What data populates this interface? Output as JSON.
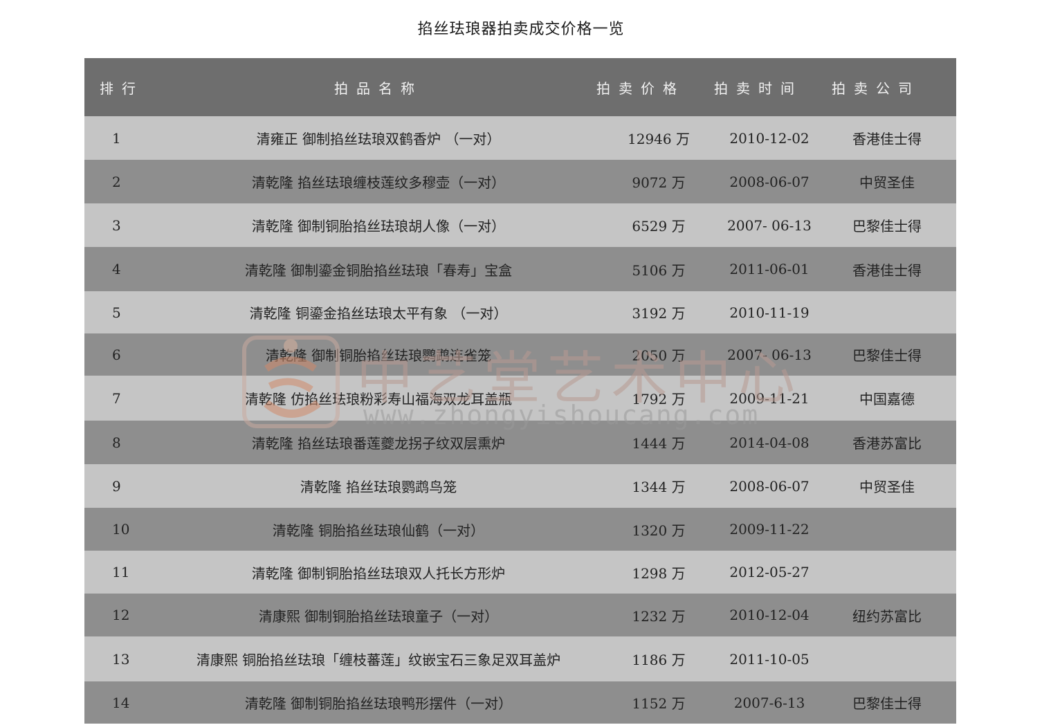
{
  "title": "掐丝珐琅器拍卖成交价格一览",
  "headers": {
    "rank": "排行",
    "name": "拍品名称",
    "price": "拍卖价格",
    "date": "拍卖时间",
    "house": "拍卖公司"
  },
  "rows": [
    {
      "rank": "1",
      "name": "清雍正  御制掐丝珐琅双鹤香炉  （一对）",
      "price": "12946 万",
      "date": "2010-12-02",
      "house": "香港佳士得"
    },
    {
      "rank": "2",
      "name": "清乾隆 掐丝珐琅缠枝莲纹多穆壶（一对）",
      "price": "9072 万",
      "date": "2008-06-07",
      "house": "中贸圣佳"
    },
    {
      "rank": "3",
      "name": "清乾隆  御制铜胎掐丝珐琅胡人像（一对）",
      "price": "6529 万",
      "date": "2007- 06-13",
      "house": "巴黎佳士得"
    },
    {
      "rank": "4",
      "name": "清乾隆  御制鎏金铜胎掐丝珐琅「春寿」宝盒",
      "price": "5106 万",
      "date": "2011-06-01",
      "house": "香港佳士得"
    },
    {
      "rank": "5",
      "name": "清乾隆  铜鎏金掐丝珐琅太平有象  （一对）",
      "price": "3192 万",
      "date": "2010-11-19",
      "house": ""
    },
    {
      "rank": "6",
      "name": "清乾隆  御制铜胎掐丝珐琅鹦鹉连雀笼",
      "price": "2050 万",
      "date": "2007- 06-13",
      "house": "巴黎佳士得"
    },
    {
      "rank": "7",
      "name": "清乾隆  仿掐丝珐琅粉彩寿山福海双龙耳盖瓶",
      "price": "1792 万",
      "date": "2009-11-21",
      "house": "中国嘉德"
    },
    {
      "rank": "8",
      "name": "清乾隆  掐丝珐琅番莲夔龙拐子纹双层熏炉",
      "price": "1444 万",
      "date": "2014-04-08",
      "house": "香港苏富比"
    },
    {
      "rank": "9",
      "name": "清乾隆  掐丝珐琅鹦鹉鸟笼",
      "price": "1344 万",
      "date": "2008-06-07",
      "house": "中贸圣佳"
    },
    {
      "rank": "10",
      "name": "清乾隆 铜胎掐丝珐琅仙鹤（一对）",
      "price": "1320 万",
      "date": "2009-11-22",
      "house": ""
    },
    {
      "rank": "11",
      "name": "清乾隆  御制铜胎掐丝珐琅双人托长方形炉",
      "price": "1298 万",
      "date": "2012-05-27",
      "house": ""
    },
    {
      "rank": "12",
      "name": "清康熙 御制铜胎掐丝珐琅童子（一对）",
      "price": "1232 万",
      "date": "2010-12-04",
      "house": "纽约苏富比"
    },
    {
      "rank": "13",
      "name": "清康熙  铜胎掐丝珐琅「缠枝蕃莲」纹嵌宝石三象足双耳盖炉",
      "price": "1186 万",
      "date": "2011-10-05",
      "house": ""
    },
    {
      "rank": "14",
      "name": "清乾隆  御制铜胎掐丝珐琅鸭形摆件（一对）",
      "price": "1152 万",
      "date": "2007-6-13",
      "house": "巴黎佳士得"
    }
  ],
  "watermark": {
    "text": "中艺堂艺术中心",
    "url": "www.zhongyishoucang.com"
  },
  "colors": {
    "header_bg": "#6e6e6e",
    "row_light": "#c5c5c5",
    "row_dark": "#8e8e8e"
  }
}
